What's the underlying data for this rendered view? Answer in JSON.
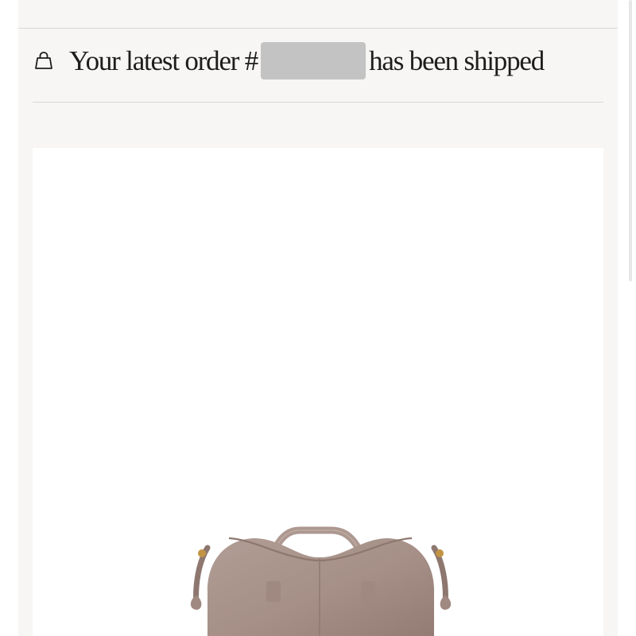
{
  "notification": {
    "icon": "shopping-bag-icon",
    "prefix": "Your latest order #",
    "suffix": "has been shipped"
  },
  "product": {
    "image": "taupe-leather-tote-bag"
  },
  "colors": {
    "card_background": "#f7f6f4",
    "divider": "#d8d6d2",
    "text": "#1f1d1b",
    "redaction": "#c3c3c3",
    "bag_leather": "#a48f86"
  }
}
